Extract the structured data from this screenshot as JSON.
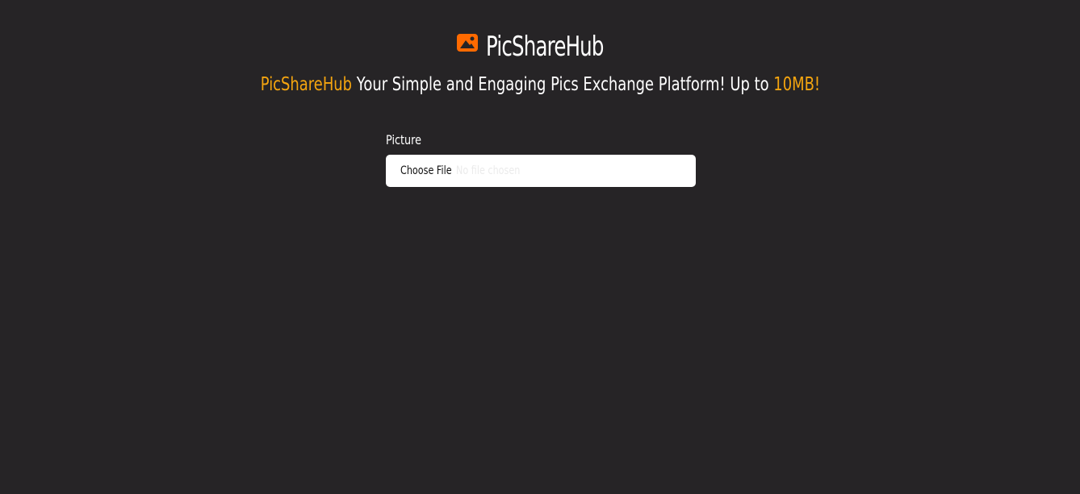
{
  "header": {
    "brand_name": "PicShareHub",
    "logo_icon": "image-icon",
    "logo_color": "#ff6a00"
  },
  "tagline": {
    "brand": "PicShareHub",
    "text": " Your Simple and Engaging Pics Exchange Platform! Up to ",
    "limit": "10MB!",
    "accent_color": "#f5a50f"
  },
  "upload_form": {
    "picture_label": "Picture",
    "choose_file_label": "Choose File",
    "file_status": "No file chosen"
  }
}
